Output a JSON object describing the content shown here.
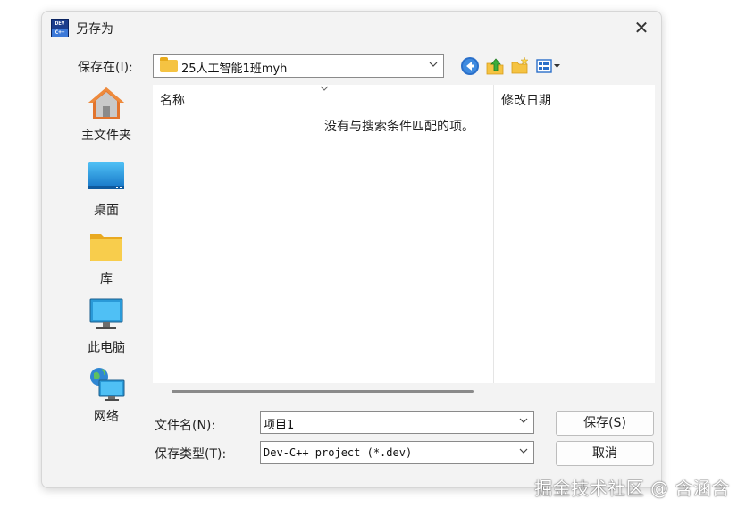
{
  "window": {
    "title": "另存为",
    "close_glyph": "✕"
  },
  "app_icon": {
    "top_text": "DEV",
    "bottom_text": "C++"
  },
  "save_in": {
    "label": "保存在(I):",
    "folder": "25人工智能1班myh"
  },
  "nav_icons": [
    "back-icon",
    "up-folder-icon",
    "new-folder-icon",
    "view-menu-icon"
  ],
  "places": [
    {
      "name": "home",
      "label": "主文件夹"
    },
    {
      "name": "desktop",
      "label": "桌面"
    },
    {
      "name": "library",
      "label": "库"
    },
    {
      "name": "this-pc",
      "label": "此电脑"
    },
    {
      "name": "network",
      "label": "网络"
    }
  ],
  "file_list": {
    "columns": [
      "名称",
      "修改日期"
    ],
    "empty_message": "没有与搜索条件匹配的项。"
  },
  "filename": {
    "label": "文件名(N):",
    "value": "项目1"
  },
  "filetype": {
    "label": "保存类型(T):",
    "value": "Dev-C++ project (*.dev)"
  },
  "buttons": {
    "save": "保存(S)",
    "cancel": "取消"
  },
  "watermark": "掘金技术社区 @ 含涵含",
  "colors": {
    "dialog_bg": "#f3f3f3",
    "folder_yellow": "#f5c342",
    "accent_blue": "#1e7cd6"
  }
}
